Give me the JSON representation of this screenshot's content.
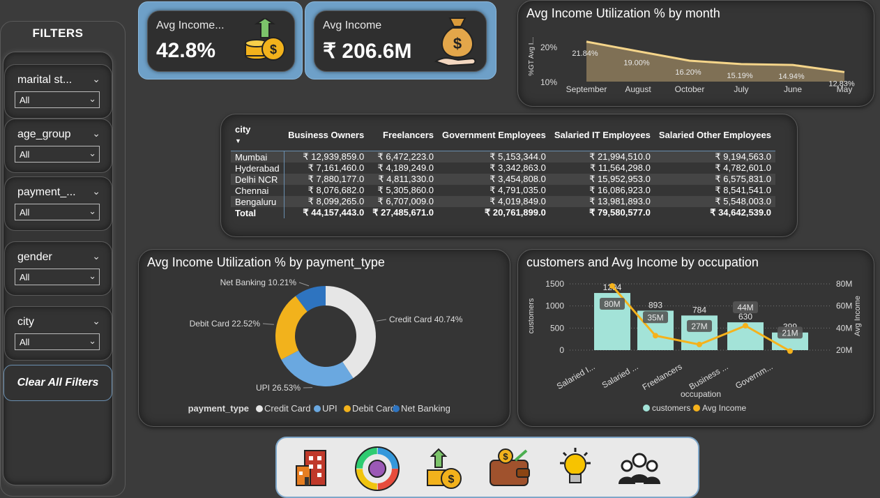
{
  "filters": {
    "title": "FILTERS",
    "slicers": [
      {
        "label": "marital st...",
        "value": "All"
      },
      {
        "label": "age_group",
        "value": "All"
      },
      {
        "label": "payment_...",
        "value": "All"
      },
      {
        "label": "gender",
        "value": "All"
      },
      {
        "label": "city",
        "value": "All"
      }
    ],
    "clear_label": "Clear All Filters"
  },
  "kpis": [
    {
      "label": "Avg Income...",
      "value": "42.8%",
      "icon": "coins-up-icon"
    },
    {
      "label": "Avg Income",
      "value": "₹ 206.6M",
      "icon": "money-bag-icon"
    }
  ],
  "month_chart": {
    "title": "Avg Income Utilization % by month",
    "ylabel": "%GT Avg I...",
    "yticks": [
      "20%",
      "10%"
    ]
  },
  "table": {
    "headers": [
      "city",
      "Business Owners",
      "Freelancers",
      "Government Employees",
      "Salaried IT Employees",
      "Salaried Other Employees"
    ],
    "rows": [
      [
        "Mumbai",
        "₹ 12,939,859.0",
        "₹ 6,472,223.0",
        "₹ 5,153,344.0",
        "₹ 21,994,510.0",
        "₹ 9,194,563.0"
      ],
      [
        "Hyderabad",
        "₹ 7,161,460.0",
        "₹ 4,189,249.0",
        "₹ 3,342,863.0",
        "₹ 11,564,298.0",
        "₹ 4,782,601.0"
      ],
      [
        "Delhi NCR",
        "₹ 7,880,177.0",
        "₹ 4,811,330.0",
        "₹ 3,454,808.0",
        "₹ 15,952,953.0",
        "₹ 6,575,831.0"
      ],
      [
        "Chennai",
        "₹ 8,076,682.0",
        "₹ 5,305,860.0",
        "₹ 4,791,035.0",
        "₹ 16,086,923.0",
        "₹ 8,541,541.0"
      ],
      [
        "Bengaluru",
        "₹ 8,099,265.0",
        "₹ 6,707,009.0",
        "₹ 4,019,849.0",
        "₹ 13,981,893.0",
        "₹ 5,548,003.0"
      ]
    ],
    "total": [
      "Total",
      "₹ 44,157,443.0",
      "₹ 27,485,671.0",
      "₹ 20,761,899.0",
      "₹ 79,580,577.0",
      "₹ 34,642,539.0"
    ]
  },
  "pie_chart": {
    "title": "Avg Income Utilization % by payment_type",
    "legend_title": "payment_type"
  },
  "combo_chart": {
    "title": "customers and Avg Income by occupation",
    "xlabel": "occupation",
    "ylabel_left": "customers",
    "ylabel_right": "Avg Income",
    "left_ticks": [
      "1500",
      "1000",
      "500",
      "0"
    ],
    "right_ticks": [
      "80M",
      "60M",
      "40M",
      "20M"
    ],
    "legend": [
      "customers",
      "Avg Income"
    ]
  },
  "nav": {
    "icons": [
      "building-icon",
      "pie-chart-icon",
      "coins-up-icon",
      "wallet-icon",
      "lightbulb-icon",
      "people-icon"
    ]
  },
  "colors": {
    "bg": "#3b3b3b",
    "kpi_frame": "#6ea0c8",
    "area": "#8c7a5a",
    "area_line": "#f5d58a",
    "credit": "#e6e6e6",
    "upi": "#6aa8e0",
    "debit": "#f2b21c",
    "netbanking": "#2e74c0",
    "bars": "#a3e3d8",
    "line": "#f5b21c"
  },
  "chart_data": [
    {
      "type": "area",
      "title": "Avg Income Utilization % by month",
      "categories": [
        "September",
        "August",
        "October",
        "July",
        "June",
        "May"
      ],
      "values": [
        21.84,
        19.0,
        16.2,
        15.19,
        14.94,
        12.83
      ],
      "labels": [
        "21.84%",
        "19.00%",
        "16.20%",
        "15.19%",
        "14.94%",
        "12.83%"
      ],
      "ylabel": "%GT Avg I...",
      "ylim": [
        10,
        22
      ]
    },
    {
      "type": "pie",
      "title": "Avg Income Utilization % by payment_type",
      "categories": [
        "Credit Card",
        "UPI",
        "Debit Card",
        "Net Banking"
      ],
      "values": [
        40.74,
        26.53,
        22.52,
        10.21
      ],
      "labels": [
        "Credit Card 40.74%",
        "UPI 26.53%",
        "Debit Card 22.52%",
        "Net Banking 10.21%"
      ]
    },
    {
      "type": "bar",
      "title": "customers and Avg Income by occupation",
      "categories": [
        "Salaried I...",
        "Salaried ...",
        "Freelancers",
        "Business ...",
        "Governm..."
      ],
      "series": [
        {
          "name": "customers",
          "values": [
            1294,
            893,
            784,
            630,
            399
          ],
          "labels": [
            "1294",
            "893",
            "784",
            "630",
            "399"
          ]
        },
        {
          "name": "Avg Income",
          "values": [
            80,
            35,
            27,
            44,
            21
          ],
          "labels": [
            "80M",
            "35M",
            "27M",
            "44M",
            "21M"
          ]
        }
      ],
      "xlabel": "occupation",
      "ylim_left": [
        0,
        1500
      ],
      "ylim_right": [
        20,
        80
      ]
    }
  ]
}
